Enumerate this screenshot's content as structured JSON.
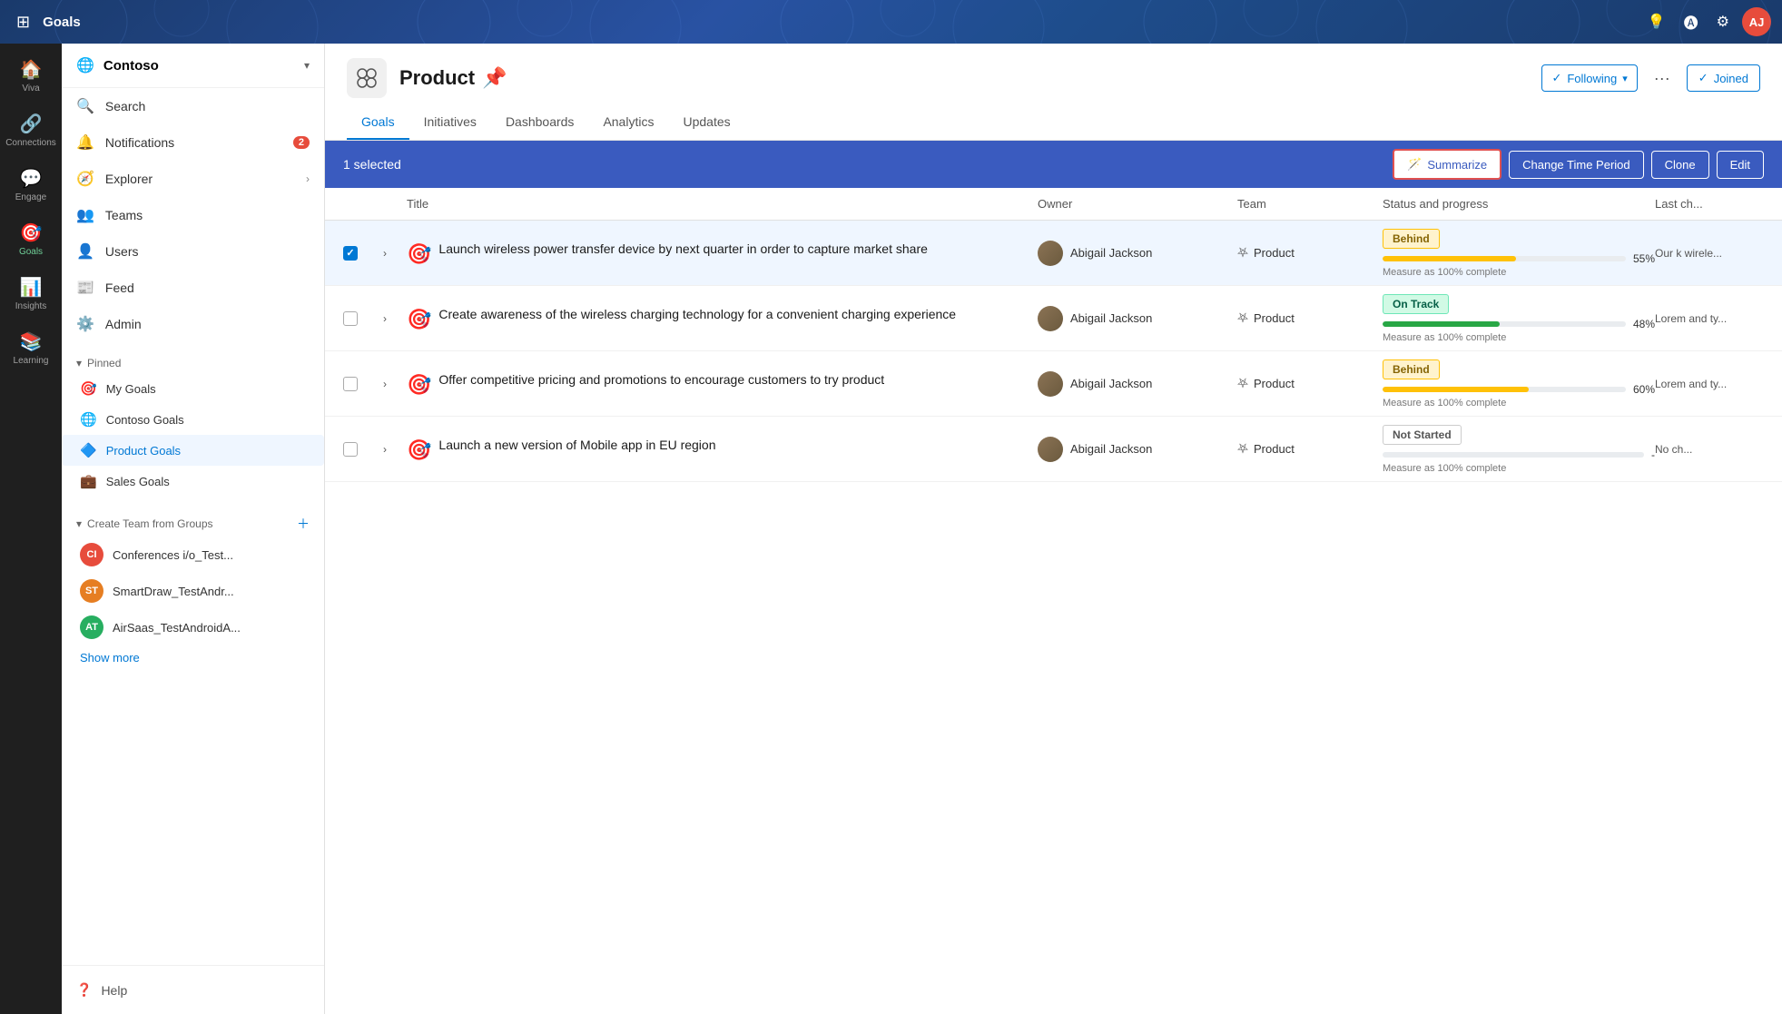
{
  "topbar": {
    "app_name": "Goals",
    "avatar_initials": "AJ"
  },
  "rail": {
    "items": [
      {
        "id": "viva",
        "label": "Viva",
        "icon": "🏠"
      },
      {
        "id": "connections",
        "label": "Connections",
        "icon": "🔗"
      },
      {
        "id": "engage",
        "label": "Engage",
        "icon": "💬"
      },
      {
        "id": "goals",
        "label": "Goals",
        "icon": "🎯",
        "active": true
      },
      {
        "id": "insights",
        "label": "Insights",
        "icon": "📊"
      },
      {
        "id": "learning",
        "label": "Learning",
        "icon": "📚"
      }
    ]
  },
  "sidebar": {
    "workspace": "Contoso",
    "nav_items": [
      {
        "id": "search",
        "label": "Search",
        "icon": "🔍"
      },
      {
        "id": "notifications",
        "label": "Notifications",
        "icon": "🔔",
        "badge": "2"
      },
      {
        "id": "explorer",
        "label": "Explorer",
        "icon": "🧭",
        "has_chevron": true
      },
      {
        "id": "teams",
        "label": "Teams",
        "icon": "👥"
      },
      {
        "id": "users",
        "label": "Users",
        "icon": "👤"
      },
      {
        "id": "feed",
        "label": "Feed",
        "icon": "📰"
      },
      {
        "id": "admin",
        "label": "Admin",
        "icon": "⚙️"
      }
    ],
    "pinned_label": "Pinned",
    "pinned_items": [
      {
        "id": "my-goals",
        "label": "My Goals",
        "icon": "🎯"
      },
      {
        "id": "contoso-goals",
        "label": "Contoso Goals",
        "icon": "🌐"
      },
      {
        "id": "product-goals",
        "label": "Product Goals",
        "icon": "🔷",
        "active": true
      },
      {
        "id": "sales-goals",
        "label": "Sales Goals",
        "icon": "💼"
      }
    ],
    "create_team_label": "Create Team from Groups",
    "groups": [
      {
        "id": "conferences",
        "label": "Conferences i/o_Test...",
        "initials": "CI",
        "color": "#e74c3c"
      },
      {
        "id": "smartdraw",
        "label": "SmartDraw_TestAndr...",
        "initials": "ST",
        "color": "#e67e22"
      },
      {
        "id": "airsaas",
        "label": "AirSaas_TestAndroidA...",
        "initials": "AT",
        "color": "#27ae60"
      }
    ],
    "show_more_label": "Show more",
    "help_label": "Help"
  },
  "page": {
    "icon": "🔷",
    "title": "Product",
    "pin_icon": "📌",
    "tabs": [
      {
        "id": "goals",
        "label": "Goals",
        "active": true
      },
      {
        "id": "initiatives",
        "label": "Initiatives"
      },
      {
        "id": "dashboards",
        "label": "Dashboards"
      },
      {
        "id": "analytics",
        "label": "Analytics"
      },
      {
        "id": "updates",
        "label": "Updates"
      }
    ],
    "following_label": "Following",
    "joined_label": "Joined",
    "more_icon": "···"
  },
  "selection_bar": {
    "count_text": "1 selected",
    "summarize_label": "Summarize",
    "change_time_period_label": "Change Time Period",
    "clone_label": "Clone",
    "edit_label": "Edit"
  },
  "table": {
    "columns": [
      "",
      "",
      "Title",
      "Owner",
      "Team",
      "Status and progress",
      "Last ch..."
    ],
    "rows": [
      {
        "id": 1,
        "selected": true,
        "title": "Launch wireless power transfer device by next quarter in order to capture market share",
        "owner": "Abigail Jackson",
        "team": "Product",
        "status": "Behind",
        "status_type": "behind",
        "progress": 55,
        "measure_text": "Measure as 100% complete",
        "last_ch": "Our k wirele..."
      },
      {
        "id": 2,
        "selected": false,
        "title": "Create awareness of the wireless charging technology for a convenient charging experience",
        "owner": "Abigail Jackson",
        "team": "Product",
        "status": "On Track",
        "status_type": "on-track",
        "progress": 48,
        "measure_text": "Measure as 100% complete",
        "last_ch": "Lorem and ty..."
      },
      {
        "id": 3,
        "selected": false,
        "title": "Offer competitive pricing and promotions to encourage customers to try product",
        "owner": "Abigail Jackson",
        "team": "Product",
        "status": "Behind",
        "status_type": "behind",
        "progress": 60,
        "measure_text": "Measure as 100% complete",
        "last_ch": "Lorem and ty..."
      },
      {
        "id": 4,
        "selected": false,
        "title": "Launch a new version of Mobile app in EU region",
        "owner": "Abigail Jackson",
        "team": "Product",
        "status": "Not Started",
        "status_type": "not-started",
        "progress": 0,
        "measure_text": "Measure as 100% complete",
        "last_ch": "No ch..."
      }
    ]
  }
}
